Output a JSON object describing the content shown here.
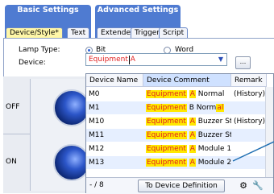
{
  "tabs": {
    "groups": [
      {
        "title": "Basic Settings",
        "subtabs": [
          {
            "label": "Device/Style*",
            "active": true
          },
          {
            "label": "Text",
            "active": false
          }
        ]
      },
      {
        "title": "Advanced Settings",
        "subtabs": [
          {
            "label": "Extended",
            "active": false
          },
          {
            "label": "Trigger",
            "active": false
          },
          {
            "label": "Script",
            "active": false
          }
        ]
      }
    ]
  },
  "form": {
    "lamp_type_label": "Lamp Type:",
    "lamp_type_options": [
      "Bit",
      "Word"
    ],
    "lamp_type_selected": "Bit",
    "device_label": "Device:",
    "device_value": "Equipment A",
    "browse_label": "..."
  },
  "preview": {
    "off_label": "OFF",
    "on_label": "ON"
  },
  "dropdown": {
    "columns": [
      "Device Name",
      "Device Comment",
      "Remark"
    ],
    "rows": [
      {
        "name": "M0",
        "comment_pre": "Equipment",
        "comment_hl": "A",
        "comment_post": " Normal",
        "remark": "(History)"
      },
      {
        "name": "M1",
        "comment_pre": "Equipment",
        "comment_hl": "",
        "comment_post": " B Norm",
        "comment_tail": "al",
        "remark": ""
      },
      {
        "name": "M10",
        "comment_pre": "Equipment",
        "comment_hl": "A",
        "comment_post": " Buzzer Stop",
        "remark": "(History)"
      },
      {
        "name": "M11",
        "comment_pre": "Equipment",
        "comment_hl": "A",
        "comment_post": " Buzzer St...",
        "remark": ""
      },
      {
        "name": "M12",
        "comment_pre": "Equipment",
        "comment_hl": "A",
        "comment_post": " Module 1 ...",
        "remark": ""
      },
      {
        "name": "M13",
        "comment_pre": "Equipment",
        "comment_hl": "A",
        "comment_post": " Module 2 ...",
        "remark": ""
      }
    ],
    "count": "- / 8",
    "to_definition": "To Device Definition"
  },
  "colors": {
    "accent": "#4f7bd1",
    "highlight": "#ffe800",
    "highlight_text": "#e02020"
  }
}
